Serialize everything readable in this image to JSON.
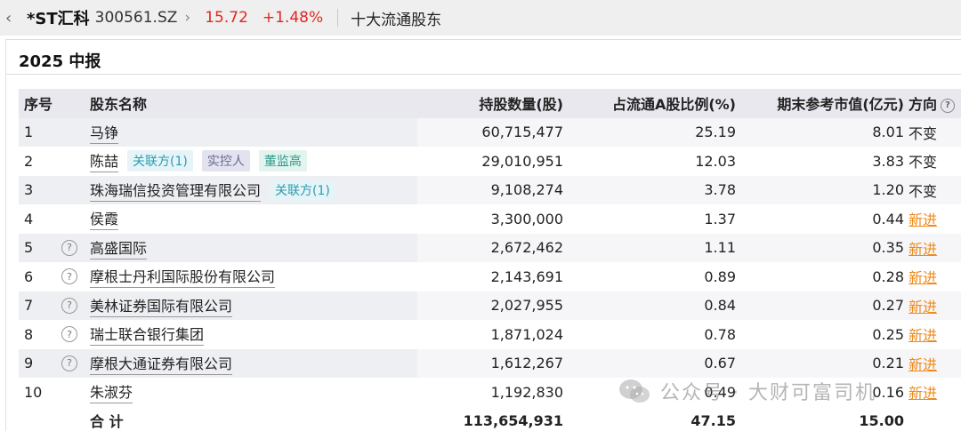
{
  "header": {
    "stock_name": "*ST汇科",
    "stock_code": "300561.SZ",
    "price": "15.72",
    "change_pct": "+1.48%",
    "tab_title": "十大流通股东"
  },
  "period": "2025 中报",
  "table": {
    "columns": {
      "no": "序号",
      "name": "股东名称",
      "shares": "持股数量(股)",
      "ratio": "占流通A股比例(%)",
      "value": "期末参考市值(亿元)",
      "direction": "方向"
    },
    "rows": [
      {
        "no": "1",
        "name": "马铮",
        "shares": "60,715,477",
        "ratio": "25.19",
        "value": "8.01",
        "direction": "不变"
      },
      {
        "no": "2",
        "name": "陈喆",
        "shares": "29,010,951",
        "ratio": "12.03",
        "value": "3.83",
        "direction": "不变",
        "tags": [
          "关联方(1)",
          "实控人",
          "董监高"
        ]
      },
      {
        "no": "3",
        "name": "珠海瑞信投资管理有限公司",
        "shares": "9,108,274",
        "ratio": "3.78",
        "value": "1.20",
        "direction": "不变",
        "tags": [
          "关联方(1)"
        ]
      },
      {
        "no": "4",
        "name": "侯霞",
        "shares": "3,300,000",
        "ratio": "1.37",
        "value": "0.44",
        "direction": "新进"
      },
      {
        "no": "5",
        "name": "高盛国际",
        "shares": "2,672,462",
        "ratio": "1.11",
        "value": "0.35",
        "direction": "新进"
      },
      {
        "no": "6",
        "name": "摩根士丹利国际股份有限公司",
        "shares": "2,143,691",
        "ratio": "0.89",
        "value": "0.28",
        "direction": "新进"
      },
      {
        "no": "7",
        "name": "美林证券国际有限公司",
        "shares": "2,027,955",
        "ratio": "0.84",
        "value": "0.27",
        "direction": "新进"
      },
      {
        "no": "8",
        "name": "瑞士联合银行集团",
        "shares": "1,871,024",
        "ratio": "0.78",
        "value": "0.25",
        "direction": "新进"
      },
      {
        "no": "9",
        "name": "摩根大通证券有限公司",
        "shares": "1,612,267",
        "ratio": "0.67",
        "value": "0.21",
        "direction": "新进"
      },
      {
        "no": "10",
        "name": "朱淑芬",
        "shares": "1,192,830",
        "ratio": "0.49",
        "value": "0.16",
        "direction": "新进"
      }
    ],
    "total": {
      "label": "合 计",
      "shares": "113,654,931",
      "ratio": "47.15",
      "value": "15.00"
    }
  },
  "watermark": "公众号 · 大财可富司机",
  "colors": {
    "up": "#e0281f",
    "new_direction": "#f08a1a",
    "tag_related": "#2a9cb3"
  }
}
